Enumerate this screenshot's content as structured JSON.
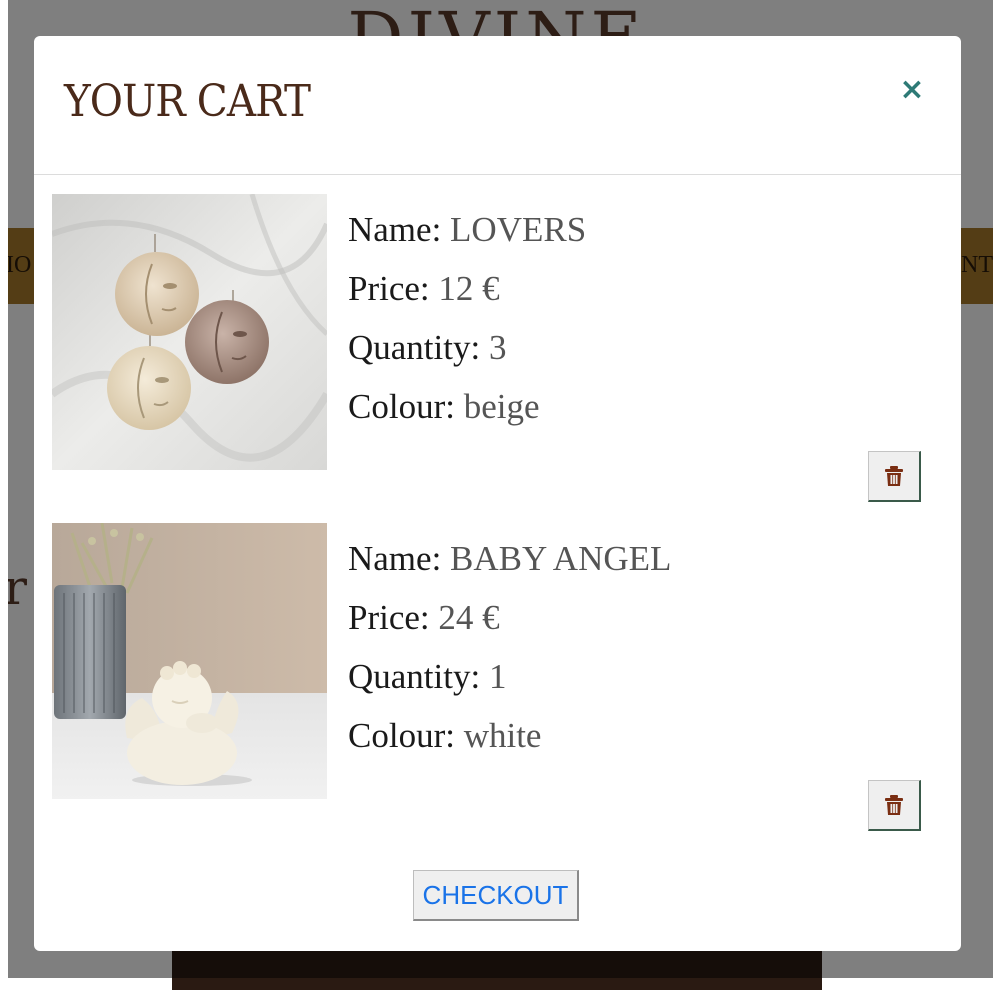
{
  "background": {
    "logo_text": "DIVINE",
    "nav_left_fragment": "IO",
    "nav_right_fragment": "NT",
    "heading_fragment": "r"
  },
  "modal": {
    "title": "YOUR CART",
    "close_symbol": "×",
    "close_icon": "close-icon",
    "items": [
      {
        "name_label": "Name:",
        "name_value": "LOVERS",
        "price_label": "Price:",
        "price_value": "12 €",
        "quantity_label": "Quantity:",
        "quantity_value": "3",
        "colour_label": "Colour:",
        "colour_value": "beige",
        "delete_icon": "trash-icon"
      },
      {
        "name_label": "Name:",
        "name_value": "BABY ANGEL",
        "price_label": "Price:",
        "price_value": "24 €",
        "quantity_label": "Quantity:",
        "quantity_value": "1",
        "colour_label": "Colour:",
        "colour_value": "white",
        "delete_icon": "trash-icon"
      }
    ],
    "checkout_label": "CHECKOUT"
  },
  "colors": {
    "accent_teal": "#2e7a76",
    "title_brown": "#4a2a1a",
    "trash_brown": "#7a2e12",
    "link_blue": "#1a73e8",
    "nav_gold": "#a87a2a"
  }
}
